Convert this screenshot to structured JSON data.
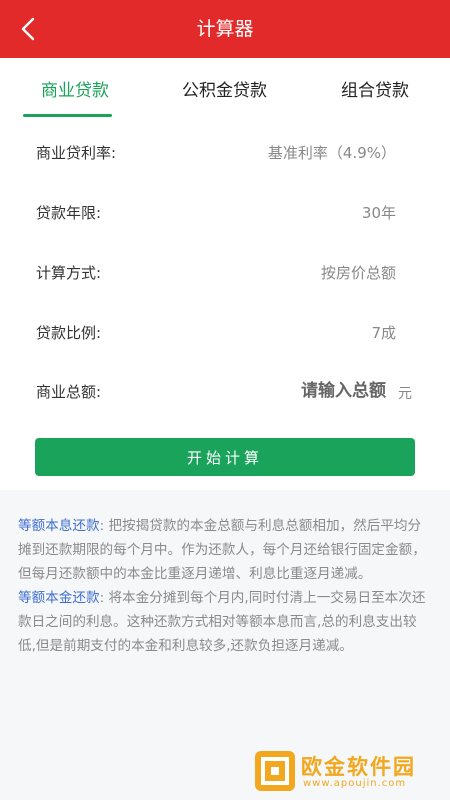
{
  "header": {
    "title": "计算器",
    "back_icon": "chevron-left-icon"
  },
  "tabs": [
    {
      "label": "商业贷款",
      "active": true
    },
    {
      "label": "公积金贷款",
      "active": false
    },
    {
      "label": "组合贷款",
      "active": false
    }
  ],
  "form": {
    "rate": {
      "label": "商业贷利率:",
      "value": "基准利率（4.9%）"
    },
    "years": {
      "label": "贷款年限:",
      "value": "30年"
    },
    "method": {
      "label": "计算方式:",
      "value": "按房价总额"
    },
    "ratio": {
      "label": "贷款比例:",
      "value": "7成"
    },
    "amount": {
      "label": "商业总额:",
      "placeholder": "请输入总额",
      "value": "",
      "unit": "元"
    }
  },
  "actions": {
    "calculate": "开始计算"
  },
  "description": {
    "p1_term": "等额本息还款",
    "p1_text": ": 把按揭贷款的本金总额与利息总额相加，然后平均分摊到还款期限的每个月中。作为还款人，每个月还给银行固定金额，但每月还款额中的本金比重逐月递增、利息比重逐月递减。",
    "p2_term": "等额本金还款",
    "p2_text": ": 将本金分摊到每个月内,同时付清上一交易日至本次还款日之间的利息。这种还款方式相对等额本息而言,总的利息支出较低,但是前期支付的本金和利息较多,还款负担逐月递减。"
  },
  "watermark": {
    "name": "欧金软件园",
    "url": "www.apoujin.com"
  },
  "colors": {
    "header": "#e32a2a",
    "accent": "#1aa35a",
    "keyword": "#3f6fd0",
    "watermark": "#f2a81e"
  }
}
